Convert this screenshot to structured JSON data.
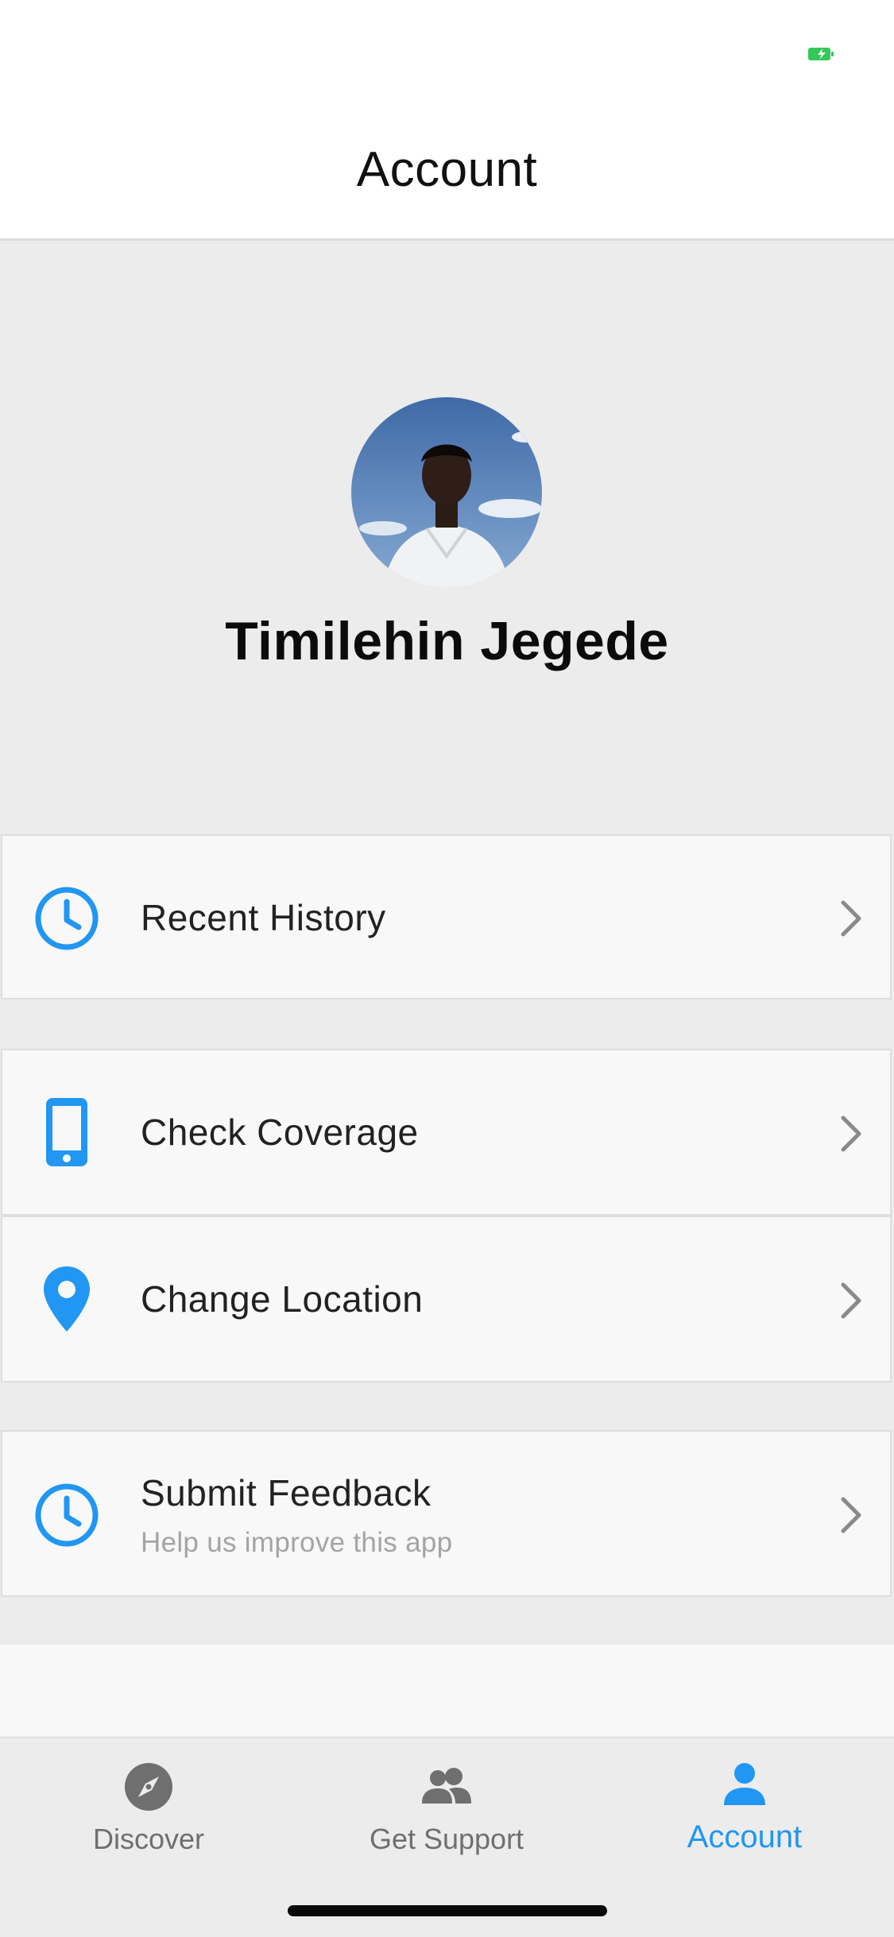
{
  "header": {
    "title": "Account"
  },
  "profile": {
    "name": "Timilehin Jegede"
  },
  "menu": {
    "items": [
      {
        "label": "Recent History",
        "icon": "clock-icon"
      },
      {
        "label": "Check Coverage",
        "icon": "phone-icon"
      },
      {
        "label": "Change Location",
        "icon": "location-pin-icon"
      },
      {
        "label": "Submit Feedback",
        "sublabel": "Help us improve this app",
        "icon": "clock-icon"
      }
    ]
  },
  "tabs": [
    {
      "label": "Discover",
      "icon": "compass-icon",
      "active": false
    },
    {
      "label": "Get Support",
      "icon": "people-icon",
      "active": false
    },
    {
      "label": "Account",
      "icon": "person-icon",
      "active": true
    }
  ],
  "colors": {
    "accent": "#2196f3",
    "inactive": "#6f6f6f",
    "battery": "#34c759",
    "background": "#ececec"
  }
}
